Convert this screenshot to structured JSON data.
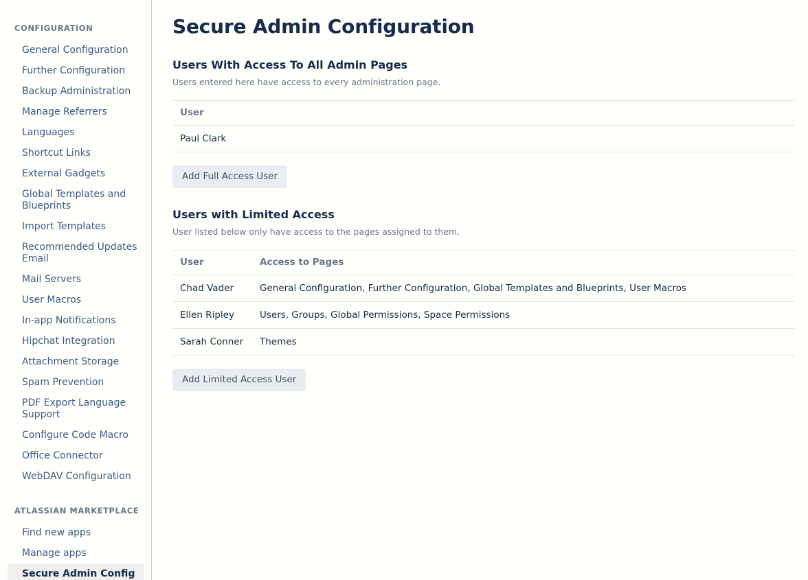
{
  "colors": {
    "page_background": "#fffffc",
    "text_primary": "#172b4d",
    "text_muted": "#6b778c",
    "link": "#3b5a86",
    "border": "#dfe3e8",
    "sidebar_border": "#c9cdd2",
    "selected_background": "#efeff0",
    "button_background": "#e9edf2",
    "scrollbar_thumb": "#26282b"
  },
  "sidebar": {
    "sections": [
      {
        "title": "CONFIGURATION",
        "items": [
          {
            "label": "General Configuration",
            "selected": false
          },
          {
            "label": "Further Configuration",
            "selected": false
          },
          {
            "label": "Backup Administration",
            "selected": false
          },
          {
            "label": "Manage Referrers",
            "selected": false
          },
          {
            "label": "Languages",
            "selected": false
          },
          {
            "label": "Shortcut Links",
            "selected": false
          },
          {
            "label": "External Gadgets",
            "selected": false
          },
          {
            "label": "Global Templates and Blueprints",
            "selected": false
          },
          {
            "label": "Import Templates",
            "selected": false
          },
          {
            "label": "Recommended Updates Email",
            "selected": false
          },
          {
            "label": "Mail Servers",
            "selected": false
          },
          {
            "label": "User Macros",
            "selected": false
          },
          {
            "label": "In-app Notifications",
            "selected": false
          },
          {
            "label": "Hipchat Integration",
            "selected": false
          },
          {
            "label": "Attachment Storage",
            "selected": false
          },
          {
            "label": "Spam Prevention",
            "selected": false
          },
          {
            "label": "PDF Export Language Support",
            "selected": false
          },
          {
            "label": "Configure Code Macro",
            "selected": false
          },
          {
            "label": "Office Connector",
            "selected": false
          },
          {
            "label": "WebDAV Configuration",
            "selected": false
          }
        ]
      },
      {
        "title": "ATLASSIAN MARKETPLACE",
        "items": [
          {
            "label": "Find new apps",
            "selected": false
          },
          {
            "label": "Manage apps",
            "selected": false
          },
          {
            "label": "Secure Admin Config",
            "selected": true
          }
        ]
      }
    ]
  },
  "main": {
    "page_title": "Secure Admin Configuration",
    "sections": [
      {
        "heading": "Users With Access To All Admin Pages",
        "description": "Users entered here have access to every administration page.",
        "table": {
          "columns": [
            "User"
          ],
          "rows": [
            [
              "Paul Clark"
            ]
          ]
        },
        "button": "Add Full Access User"
      },
      {
        "heading": "Users with Limited Access",
        "description": "User listed below only have access to the pages assigned to them.",
        "table": {
          "columns": [
            "User",
            "Access to Pages"
          ],
          "rows": [
            [
              "Chad Vader",
              "General Configuration, Further Configuration, Global Templates and Blueprints, User Macros"
            ],
            [
              "Ellen Ripley",
              "Users, Groups, Global Permissions, Space Permissions"
            ],
            [
              "Sarah Conner",
              "Themes"
            ]
          ]
        },
        "button": "Add Limited Access User"
      }
    ]
  }
}
